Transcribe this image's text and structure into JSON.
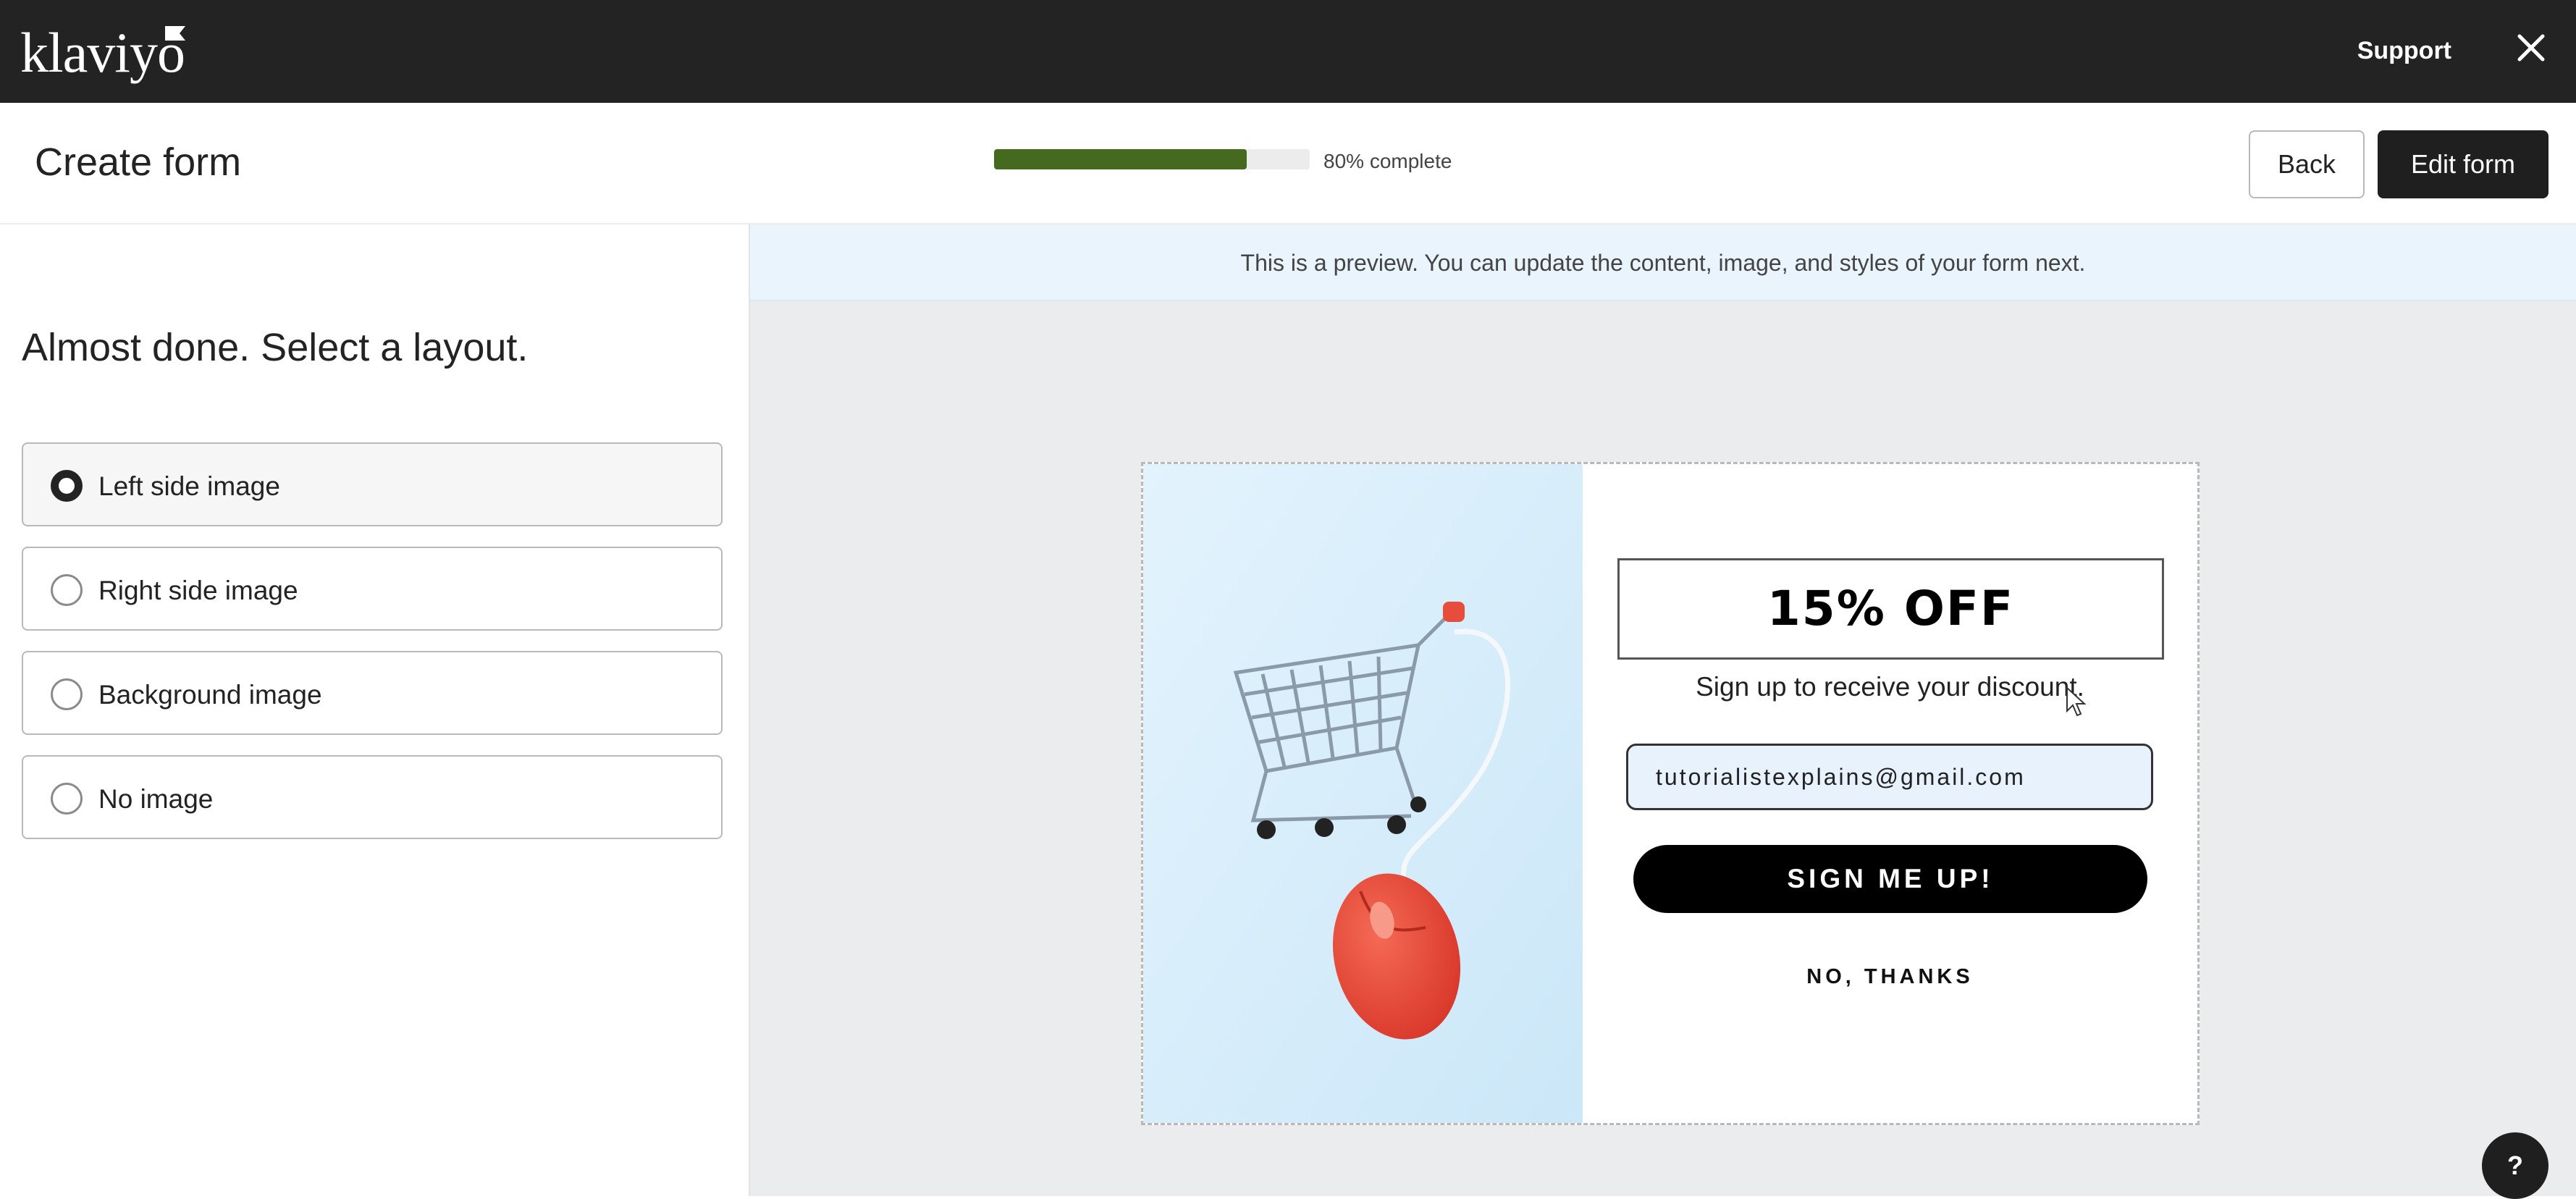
{
  "app": {
    "logo_text": "klaviyo",
    "support_label": "Support",
    "close_icon": "close-icon"
  },
  "header": {
    "title": "Create form",
    "progress": {
      "fraction": 0.8,
      "label": "80% complete",
      "fill_color": "#44691f"
    },
    "back_label": "Back",
    "edit_label": "Edit form"
  },
  "sidebar": {
    "heading": "Almost done. Select a layout.",
    "options": [
      {
        "label": "Left side image",
        "selected": true
      },
      {
        "label": "Right side image",
        "selected": false
      },
      {
        "label": "Background image",
        "selected": false
      },
      {
        "label": "No image",
        "selected": false
      }
    ]
  },
  "preview": {
    "banner_text": "This is a preview. You can update the content, image, and styles of your form next.",
    "image_icon": "shopping-cart-mouse-image",
    "offer_title": "15% OFF",
    "subtitle": "Sign up to receive your discount.",
    "email_value": "tutorialistexplains@gmail.com",
    "submit_label": "SIGN ME UP!",
    "decline_label": "NO, THANKS"
  },
  "help": {
    "label": "?"
  }
}
